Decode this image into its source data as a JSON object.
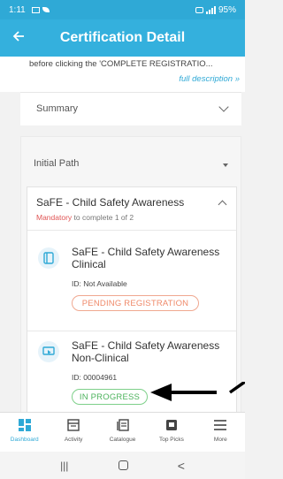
{
  "status_bar": {
    "time": "1:11",
    "battery": "95%"
  },
  "app_bar": {
    "back_icon": "arrow-left-icon",
    "title": "Certification Detail"
  },
  "description": {
    "text": "before clicking the 'COMPLETE REGISTRATIO...",
    "link": "full description »"
  },
  "summary": {
    "label": "Summary"
  },
  "initial_path": {
    "label": "Initial Path",
    "course": {
      "title": "SaFE - Child Safety Awareness",
      "mandatory_label": "Mandatory",
      "mandatory_rest": " to complete 1 of 2",
      "items": [
        {
          "name": "SaFE - Child Safety Awareness Clinical",
          "id": "ID: Not Available",
          "status": "PENDING REGISTRATION",
          "icon": "book-icon"
        },
        {
          "name": "SaFE - Child Safety Awareness Non-Clinical",
          "id": "ID: 00004961",
          "status": "IN PROGRESS",
          "icon": "screen-pointer-icon"
        }
      ]
    }
  },
  "tabs": [
    {
      "label": "Dashboard",
      "icon": "dashboard-icon",
      "active": true
    },
    {
      "label": "Activity",
      "icon": "activity-icon",
      "active": false
    },
    {
      "label": "Catalogue",
      "icon": "catalogue-icon",
      "active": false
    },
    {
      "label": "Top Picks",
      "icon": "top-picks-icon",
      "active": false
    },
    {
      "label": "More",
      "icon": "menu-icon",
      "active": false
    }
  ],
  "nav_bar": {
    "recents": "|||",
    "back": "<"
  },
  "colors": {
    "accent": "#34b0dd",
    "pending": "#ef8a6a",
    "progress": "#4db35d",
    "mandatory": "#e05555"
  }
}
